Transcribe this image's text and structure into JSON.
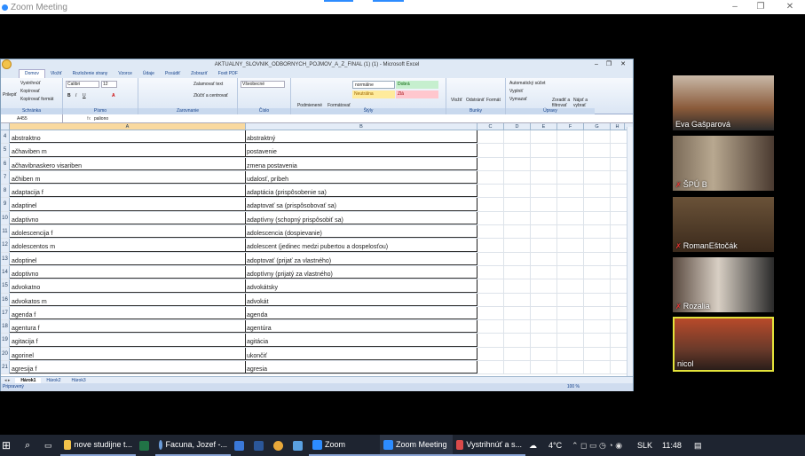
{
  "zoom": {
    "title": "Zoom Meeting",
    "win_min": "–",
    "win_max": "❐",
    "win_close": "✕"
  },
  "excel": {
    "title": "AKTUALNY_SLOVNIK_ODBORNYCH_POJMOV_A_Z_FINAL (1) (1) - Microsoft Excel",
    "tabs": [
      "Domov",
      "Vložiť",
      "Rozloženie strany",
      "Vzorce",
      "Údaje",
      "Posúdiť",
      "Zobraziť",
      "Foxit PDF"
    ],
    "ribbon": {
      "clipboard": {
        "paste": "Prilepiť",
        "cut": "Vystrihnúť",
        "copy": "Kopírovať",
        "format": "Kopírovať formát",
        "group": "Schránka"
      },
      "font": {
        "name": "Calibri",
        "size": "12",
        "group": "Písmo"
      },
      "align": {
        "wrap": "Zalamovať text",
        "merge": "Zlúčiť a centrovať",
        "group": "Zarovnanie"
      },
      "number": {
        "format": "Všeobecné",
        "group": "Číslo"
      },
      "styles": {
        "cond": "Podmienené formátovanie",
        "table": "Formátovať ako tabuľku",
        "normal": "normálne",
        "good": "Dobrá",
        "neutral": "Neutrálna",
        "bad": "Zlá",
        "group": "Štýly"
      },
      "cells": {
        "insert": "Vložiť",
        "delete": "Odstrániť",
        "format": "Formát",
        "group": "Bunky"
      },
      "edit": {
        "autosum": "Automatický súčet",
        "fill": "Vyplniť",
        "clear": "Vymazať",
        "sort": "Zoradiť a filtrovať",
        "find": "Nájsť a vybrať",
        "group": "Úpravy"
      }
    },
    "namebox": "A455",
    "formula": "paliono",
    "columns": [
      "A",
      "B",
      "C",
      "D",
      "E",
      "F",
      "G",
      "H"
    ],
    "rows": [
      {
        "n": "4",
        "a": "abstraktno",
        "b": "abstraktný"
      },
      {
        "n": "5",
        "a": "ačhaviben m",
        "b": "postavenie"
      },
      {
        "n": "6",
        "a": "ačhavibnaskero visariben",
        "b": "zmena postavenia"
      },
      {
        "n": "7",
        "a": "ačhiben m",
        "b": "udalosť, príbeh"
      },
      {
        "n": "8",
        "a": "adaptacija f",
        "b": "adaptácia (prispôsobenie sa)"
      },
      {
        "n": "9",
        "a": "adaptinel",
        "b": "adaptovať sa (prispôsobovať sa)"
      },
      {
        "n": "10",
        "a": "adaptivno",
        "b": "adaptívny (schopný prispôsobiť sa)"
      },
      {
        "n": "11",
        "a": "adolescencija f",
        "b": "adolescencia (dospievanie)"
      },
      {
        "n": "12",
        "a": "adolescentos m",
        "b": "adolescent (jedinec medzi pubertou a dospelosťou)"
      },
      {
        "n": "13",
        "a": "adoptinel",
        "b": "adoptovať (prijať za vlastného)"
      },
      {
        "n": "14",
        "a": "adoptivno",
        "b": "adoptívny (prijatý za vlastného)"
      },
      {
        "n": "15",
        "a": "advokatno",
        "b": "advokátsky"
      },
      {
        "n": "16",
        "a": "advokatos m",
        "b": "advokát"
      },
      {
        "n": "17",
        "a": "agenda f",
        "b": "agenda"
      },
      {
        "n": "18",
        "a": "agentura f",
        "b": "agentúra"
      },
      {
        "n": "19",
        "a": "agitacija f",
        "b": "agitácia"
      },
      {
        "n": "20",
        "a": "agorinel",
        "b": "ukončiť"
      },
      {
        "n": "21",
        "a": "agresija f",
        "b": "agresia"
      }
    ],
    "sheets": [
      "Hárok1",
      "Hárok2",
      "Hárok3"
    ],
    "status": "Pripravený",
    "zoom_level": "100 %"
  },
  "participants": [
    {
      "name": "Eva Gašparová",
      "muted": false
    },
    {
      "name": "ŠPÚ B",
      "muted": true
    },
    {
      "name": "RomanEštočák",
      "muted": true
    },
    {
      "name": "Rozalia",
      "muted": true
    },
    {
      "name": "nicol",
      "muted": false
    }
  ],
  "taskbar": {
    "items": [
      "nove studijne t...",
      "Facuna, Jozef -...",
      "Zoom",
      "Zoom Meeting",
      "Vystrihnúť a s..."
    ],
    "temp": "4°C",
    "lang": "SLK",
    "time": "11:48"
  },
  "colors": {
    "accent": "#2d8cff",
    "excel_sel": "#f9d99f",
    "active_speaker": "#e3e33a"
  }
}
